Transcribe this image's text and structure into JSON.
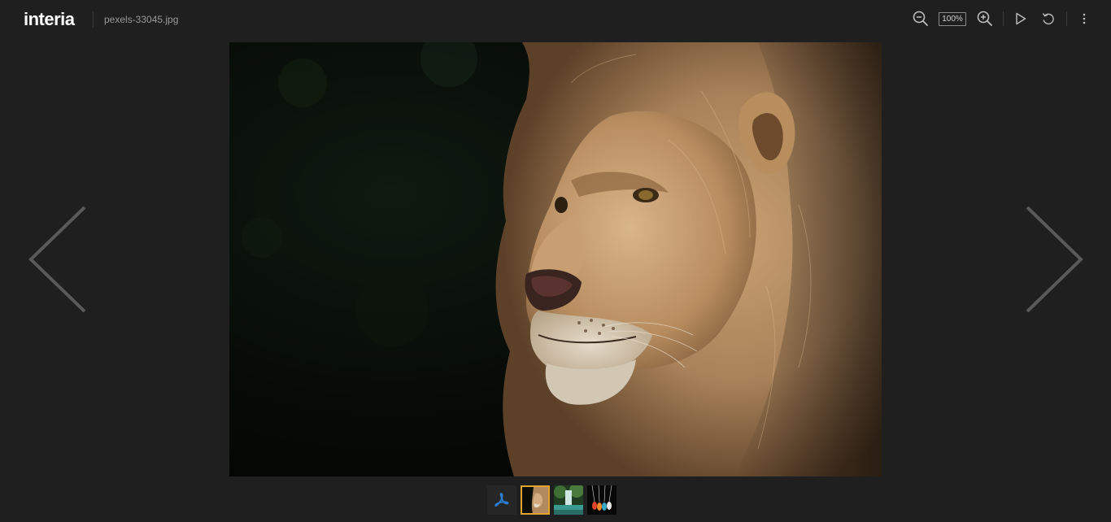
{
  "app": {
    "logo_text": "interia",
    "filename": "pexels-33045.jpg"
  },
  "toolbar": {
    "zoom_out_icon": "zoom-out-icon",
    "zoom_level": "100%",
    "zoom_in_icon": "zoom-in-icon",
    "play_icon": "play-icon",
    "rotate_icon": "rotate-icon",
    "more_icon": "more-vertical-icon"
  },
  "viewer": {
    "image_subject": "lion",
    "prev_icon": "chevron-left-icon",
    "next_icon": "chevron-right-icon"
  },
  "thumbnails": [
    {
      "type": "pdf",
      "icon": "pdf-icon",
      "active": false
    },
    {
      "type": "image",
      "subject": "lion",
      "active": true
    },
    {
      "type": "image",
      "subject": "waterfall",
      "active": false
    },
    {
      "type": "image",
      "subject": "feathers",
      "active": false
    }
  ],
  "colors": {
    "background": "#1f1f1f",
    "active_thumb_border": "#e0a52a",
    "pdf_icon": "#2a7fd4"
  }
}
